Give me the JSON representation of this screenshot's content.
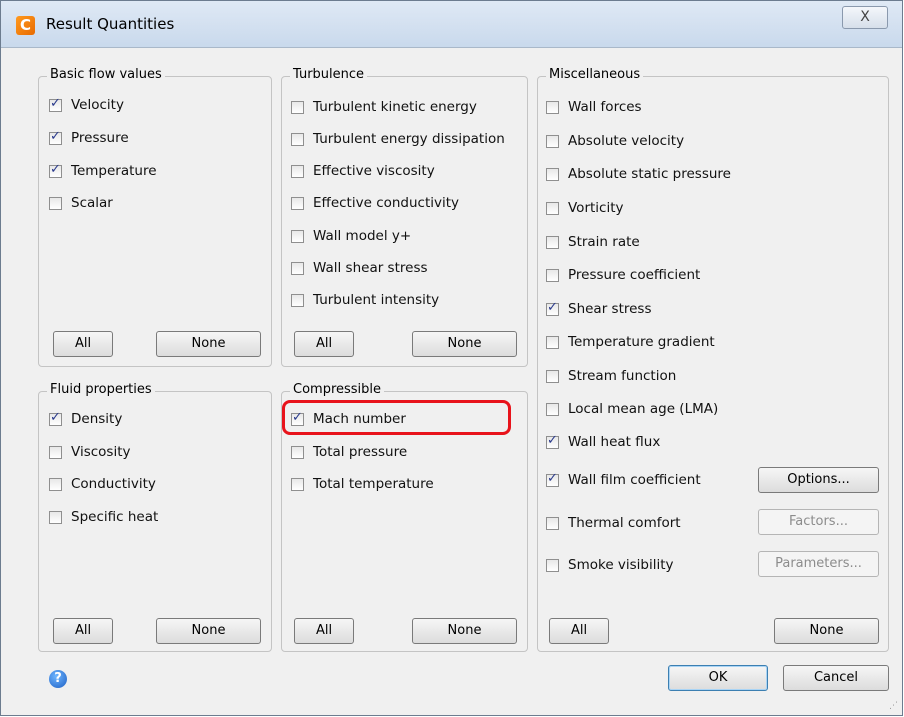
{
  "window": {
    "title": "Result Quantities",
    "close_label": "X"
  },
  "panels": {
    "basic": {
      "title": "Basic flow values",
      "items": [
        {
          "label": "Velocity",
          "checked": true
        },
        {
          "label": "Pressure",
          "checked": true
        },
        {
          "label": "Temperature",
          "checked": true
        },
        {
          "label": "Scalar",
          "checked": false
        }
      ],
      "all_label": "All",
      "none_label": "None"
    },
    "turbulence": {
      "title": "Turbulence",
      "items": [
        {
          "label": "Turbulent kinetic energy",
          "checked": false
        },
        {
          "label": "Turbulent energy dissipation",
          "checked": false
        },
        {
          "label": "Effective viscosity",
          "checked": false
        },
        {
          "label": "Effective conductivity",
          "checked": false
        },
        {
          "label": "Wall model y+",
          "checked": false
        },
        {
          "label": "Wall shear stress",
          "checked": false
        },
        {
          "label": "Turbulent intensity",
          "checked": false
        }
      ],
      "all_label": "All",
      "none_label": "None"
    },
    "misc": {
      "title": "Miscellaneous",
      "items": [
        {
          "label": "Wall forces",
          "checked": false
        },
        {
          "label": "Absolute velocity",
          "checked": false
        },
        {
          "label": "Absolute static pressure",
          "checked": false
        },
        {
          "label": "Vorticity",
          "checked": false
        },
        {
          "label": "Strain rate",
          "checked": false
        },
        {
          "label": "Pressure coefficient",
          "checked": false
        },
        {
          "label": "Shear stress",
          "checked": true
        },
        {
          "label": "Temperature gradient",
          "checked": false
        },
        {
          "label": "Stream function",
          "checked": false
        },
        {
          "label": "Local mean age (LMA)",
          "checked": false
        },
        {
          "label": "Wall heat flux",
          "checked": true
        },
        {
          "label": "Wall film coefficient",
          "checked": true
        },
        {
          "label": "Thermal comfort",
          "checked": false
        },
        {
          "label": "Smoke visibility",
          "checked": false
        }
      ],
      "options_label": "Options...",
      "factors_label": "Factors...",
      "parameters_label": "Parameters...",
      "all_label": "All",
      "none_label": "None"
    },
    "fluid": {
      "title": "Fluid properties",
      "items": [
        {
          "label": "Density",
          "checked": true
        },
        {
          "label": "Viscosity",
          "checked": false
        },
        {
          "label": "Conductivity",
          "checked": false
        },
        {
          "label": "Specific heat",
          "checked": false
        }
      ],
      "all_label": "All",
      "none_label": "None"
    },
    "compressible": {
      "title": "Compressible",
      "items": [
        {
          "label": "Mach number",
          "checked": true
        },
        {
          "label": "Total pressure",
          "checked": false
        },
        {
          "label": "Total temperature",
          "checked": false
        }
      ],
      "all_label": "All",
      "none_label": "None"
    }
  },
  "footer": {
    "ok_label": "OK",
    "cancel_label": "Cancel",
    "help_label": "?"
  }
}
